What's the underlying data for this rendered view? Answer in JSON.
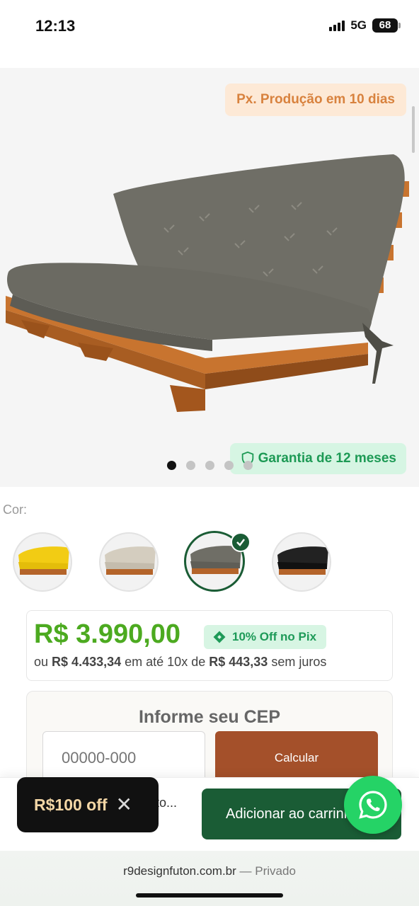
{
  "status_bar": {
    "time": "12:13",
    "network": "5G",
    "battery": "68"
  },
  "product": {
    "badge_production": "Px. Produção em 10 dias",
    "badge_warranty": "Garantia de 12 meses",
    "image_dots_count": 5,
    "image_active_index": 0
  },
  "color": {
    "label": "Cor:",
    "options": [
      "yellow",
      "beige",
      "gray",
      "black"
    ],
    "selected": "gray",
    "swatch_colors": {
      "yellow": "#f2cc14",
      "beige": "#cfc7b8",
      "gray": "#6b6a63",
      "black": "#1c1c1c",
      "wood": "#b4642a"
    }
  },
  "price": {
    "value": "R$ 3.990,00",
    "pix_badge": "10% Off no Pix",
    "installments_prefix": "ou",
    "full_price": "R$ 4.433,34",
    "installments_mid": "em até 10x de",
    "installment_value": "R$ 443,33",
    "installments_suffix": "sem juros"
  },
  "cep": {
    "title": "Informe seu CEP",
    "placeholder": "00000-000",
    "button": "Calcular"
  },
  "sticky": {
    "partial_text": "to...",
    "add_to_cart": "Adicionar ao carrinho"
  },
  "coupon": {
    "label": "R$100 off",
    "close": "✕"
  },
  "browser": {
    "domain": "r9designfuton.com.br",
    "mode": "— Privado"
  },
  "colors": {
    "price_green": "#4caa20",
    "primary_green": "#1a5c35",
    "calc_brown": "#a4502a",
    "whatsapp": "#25d366"
  }
}
